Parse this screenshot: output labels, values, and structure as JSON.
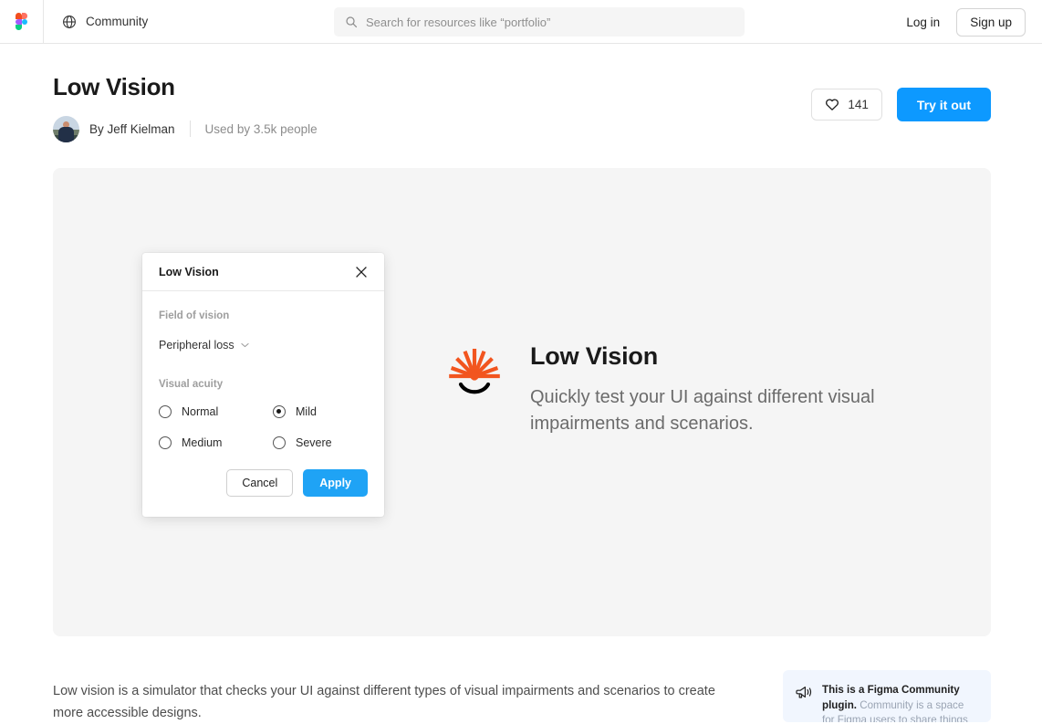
{
  "topbar": {
    "logo_icon": "figma-logo-icon",
    "community_label": "Community",
    "community_icon": "globe-icon",
    "search": {
      "icon": "search-icon",
      "placeholder": "Search for resources like “portfolio”",
      "value": ""
    },
    "login_label": "Log in",
    "signup_label": "Sign up"
  },
  "page": {
    "title": "Low Vision",
    "author_prefix": "By ",
    "author_name": "Jeff Kielman",
    "author_label": "By Jeff Kielman",
    "usage": "Used by 3.5k people",
    "avatar_name": "avatar",
    "like": {
      "icon": "heart-icon",
      "count": "141"
    },
    "try_label": "Try it out"
  },
  "hero": {
    "logo_icon": "low-vision-sunburst-icon",
    "title": "Low Vision",
    "subtitle": "Quickly test your UI against different visual impairments and scenarios."
  },
  "dialog": {
    "title": "Low Vision",
    "close_icon": "close-icon",
    "field_of_vision": {
      "label": "Field of vision",
      "selected": "Peripheral loss",
      "chevron_icon": "chevron-down-icon"
    },
    "visual_acuity": {
      "label": "Visual acuity",
      "options": [
        {
          "label": "Normal",
          "selected": false
        },
        {
          "label": "Mild",
          "selected": true
        },
        {
          "label": "Medium",
          "selected": false
        },
        {
          "label": "Severe",
          "selected": false
        }
      ]
    },
    "cancel_label": "Cancel",
    "apply_label": "Apply"
  },
  "description": "Low vision is a simulator that checks your UI against different types of visual impairments and scenarios to create more accessible designs.",
  "callout": {
    "icon": "megaphone-icon",
    "strong": "This is a Figma Community plugin.",
    "rest": " Community is a space for Figma users to share things"
  },
  "colors": {
    "accent_blue": "#0d99ff",
    "apply_blue": "#1fa3f5",
    "canvas_bg": "#f5f5f5",
    "callout_bg": "#f1f6fe",
    "sunburst_orange": "#f2551f"
  }
}
